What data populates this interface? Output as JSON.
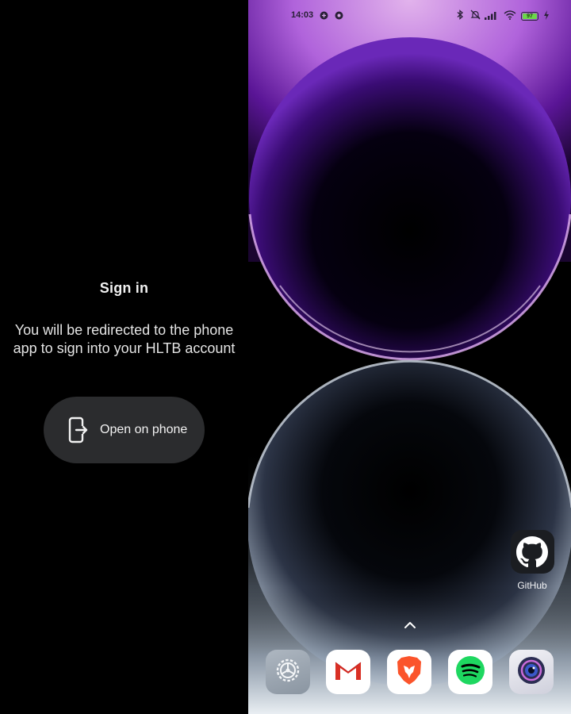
{
  "watch": {
    "title": "Sign in",
    "message": "You will be redirected to the phone app to sign into your HLTB account",
    "button_label": "Open on phone",
    "button_icon": "open-on-phone-icon"
  },
  "phone": {
    "status_bar": {
      "time": "14:03",
      "battery_level": "97",
      "icons": [
        "notification-icon",
        "notification-icon",
        "bluetooth-icon",
        "mute-icon",
        "signal-icon",
        "wifi-icon",
        "battery-icon",
        "charging-icon"
      ]
    },
    "shortcut": {
      "label": "GitHub",
      "icon": "github-icon"
    },
    "dock": [
      {
        "name": "settings",
        "icon": "settings-icon",
        "color": "#9aa5b0"
      },
      {
        "name": "gmail",
        "icon": "gmail-icon",
        "color": "#d93025"
      },
      {
        "name": "brave",
        "icon": "brave-icon",
        "color": "#fb542b"
      },
      {
        "name": "spotify",
        "icon": "spotify-icon",
        "color": "#1ed760"
      },
      {
        "name": "camera",
        "icon": "camera-icon",
        "color": "#3a3f7a"
      }
    ]
  }
}
